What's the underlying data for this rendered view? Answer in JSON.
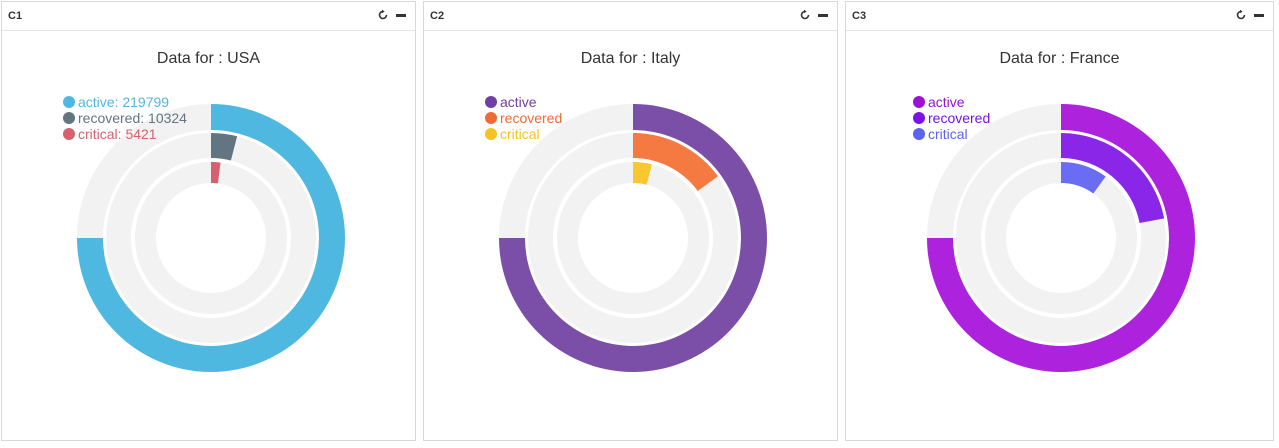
{
  "panels": [
    {
      "id": "C1",
      "chart_data": {
        "type": "radialBar",
        "title": "Data for : USA",
        "series": [
          {
            "name": "active",
            "value": 219799,
            "legend": "active: 219799",
            "color": "#4fb8e0"
          },
          {
            "name": "recovered",
            "value": 10324,
            "legend": "recovered: 10324",
            "color": "#627580"
          },
          {
            "name": "critical",
            "value": 5421,
            "legend": "critical: 5421",
            "color": "#d7606f"
          }
        ],
        "fractions": [
          0.75,
          0.04,
          0.02
        ],
        "legend_colors": [
          "#4fb8e0",
          "#627580",
          "#d7606f"
        ]
      }
    },
    {
      "id": "C2",
      "chart_data": {
        "type": "radialBar",
        "title": "Data for : Italy",
        "series": [
          {
            "name": "active",
            "legend": "active",
            "color": "#7b4ea8"
          },
          {
            "name": "recovered",
            "legend": "recovered",
            "color": "#f47a41"
          },
          {
            "name": "critical",
            "legend": "critical",
            "color": "#f9c830"
          }
        ],
        "fractions": [
          0.75,
          0.15,
          0.04
        ],
        "legend_colors": [
          "#6f3fa6",
          "#f26a33",
          "#f5c224"
        ]
      }
    },
    {
      "id": "C3",
      "chart_data": {
        "type": "radialBar",
        "title": "Data for : France",
        "series": [
          {
            "name": "active",
            "legend": "active",
            "color": "#ad22dd"
          },
          {
            "name": "recovered",
            "legend": "recovered",
            "color": "#8a26e8"
          },
          {
            "name": "critical",
            "legend": "critical",
            "color": "#6b6cf4"
          }
        ],
        "fractions": [
          0.75,
          0.22,
          0.1
        ],
        "legend_colors": [
          "#9c12d6",
          "#7a12e6",
          "#5d62f0"
        ]
      }
    }
  ],
  "track_color": "#f2f2f2",
  "icons": {
    "refresh": "refresh-icon",
    "minimize": "minimize-icon"
  }
}
